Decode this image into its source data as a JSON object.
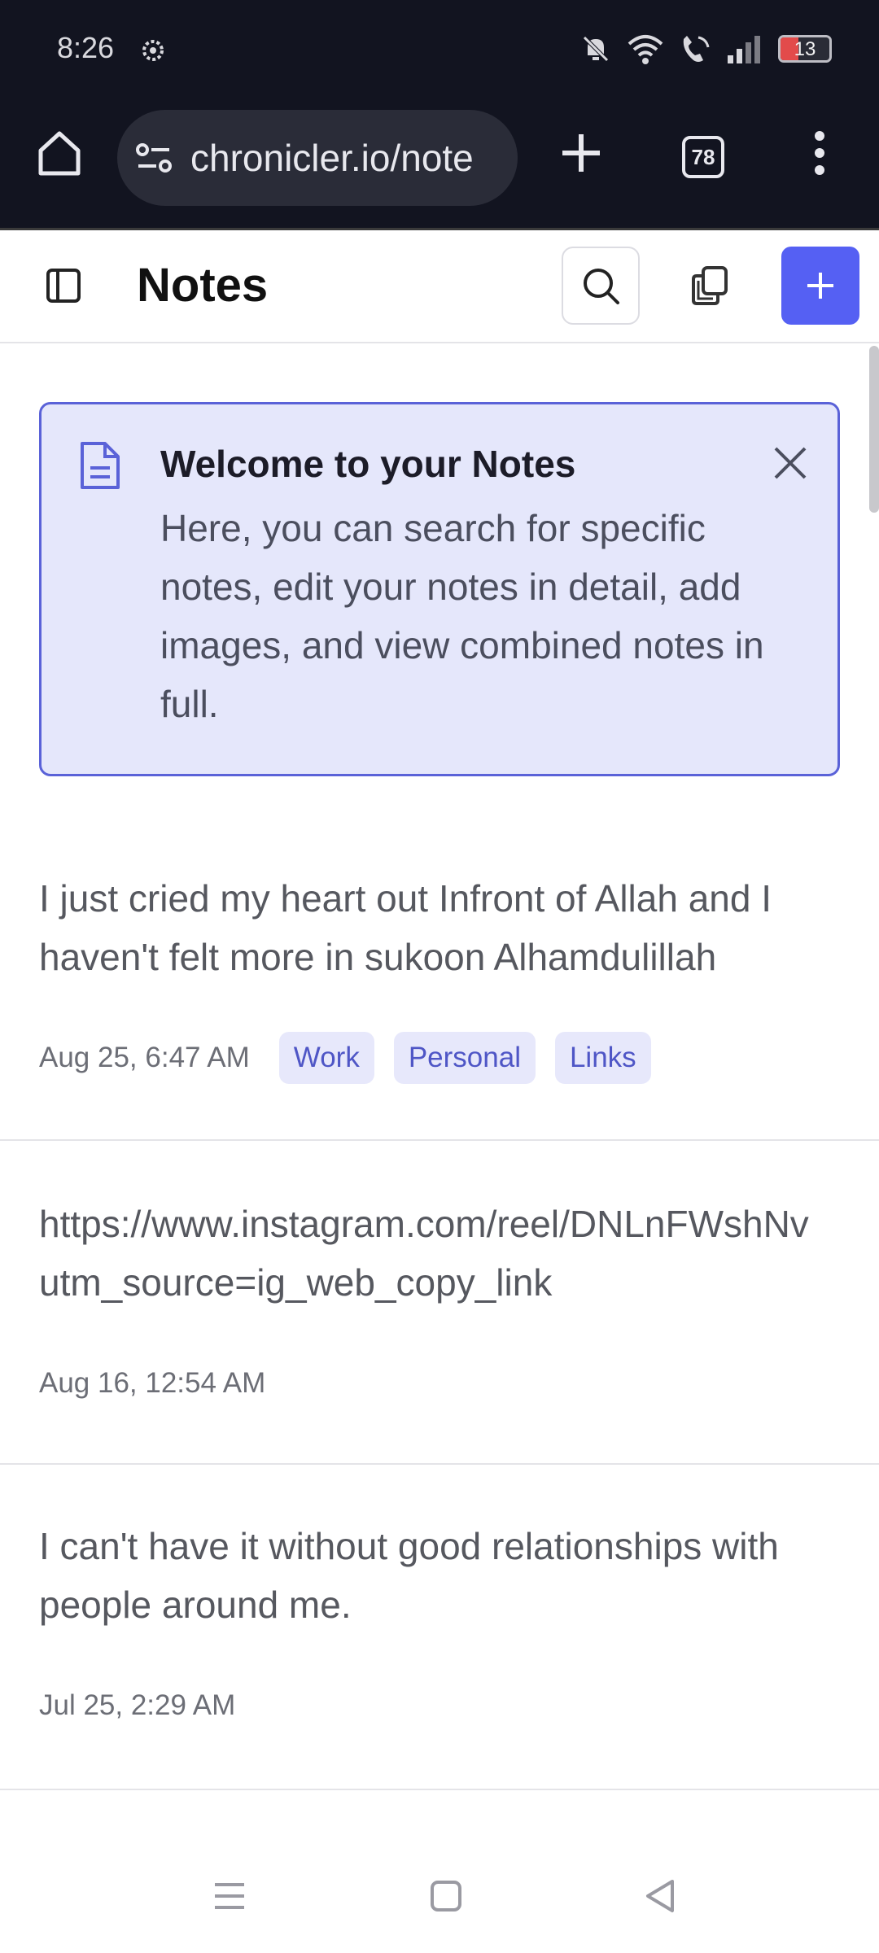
{
  "status_bar": {
    "time": "8:26",
    "battery": "13",
    "icons": [
      "gear-icon",
      "bell-off-icon",
      "wifi-icon",
      "wifi-call-icon",
      "signal-icon",
      "battery-icon"
    ]
  },
  "browser": {
    "url": "chronicler.io/note",
    "tab_count": "78",
    "icons": [
      "home-icon",
      "site-settings-icon",
      "new-tab-icon",
      "tabs-icon",
      "menu-icon"
    ]
  },
  "header": {
    "title": "Notes",
    "accent_color": "#5560f3"
  },
  "welcome": {
    "title": "Welcome to your Notes",
    "body": "Here, you can search for specific notes, edit your notes in detail, add images, and view combined notes in full."
  },
  "notes": [
    {
      "text": "I just cried my heart out Infront of Allah and I haven't felt more in sukoon Alhamdulillah",
      "date": "Aug 25, 6:47 AM",
      "tags": [
        "Work",
        "Personal",
        "Links"
      ]
    },
    {
      "text": "https://www.instagram.com/reel/DNLnFWshNv\nutm_source=ig_web_copy_link",
      "date": "Aug 16, 12:54 AM",
      "tags": []
    },
    {
      "text": "I can't have it without good relationships with people around me.",
      "date": "Jul 25, 2:29 AM",
      "tags": []
    }
  ]
}
